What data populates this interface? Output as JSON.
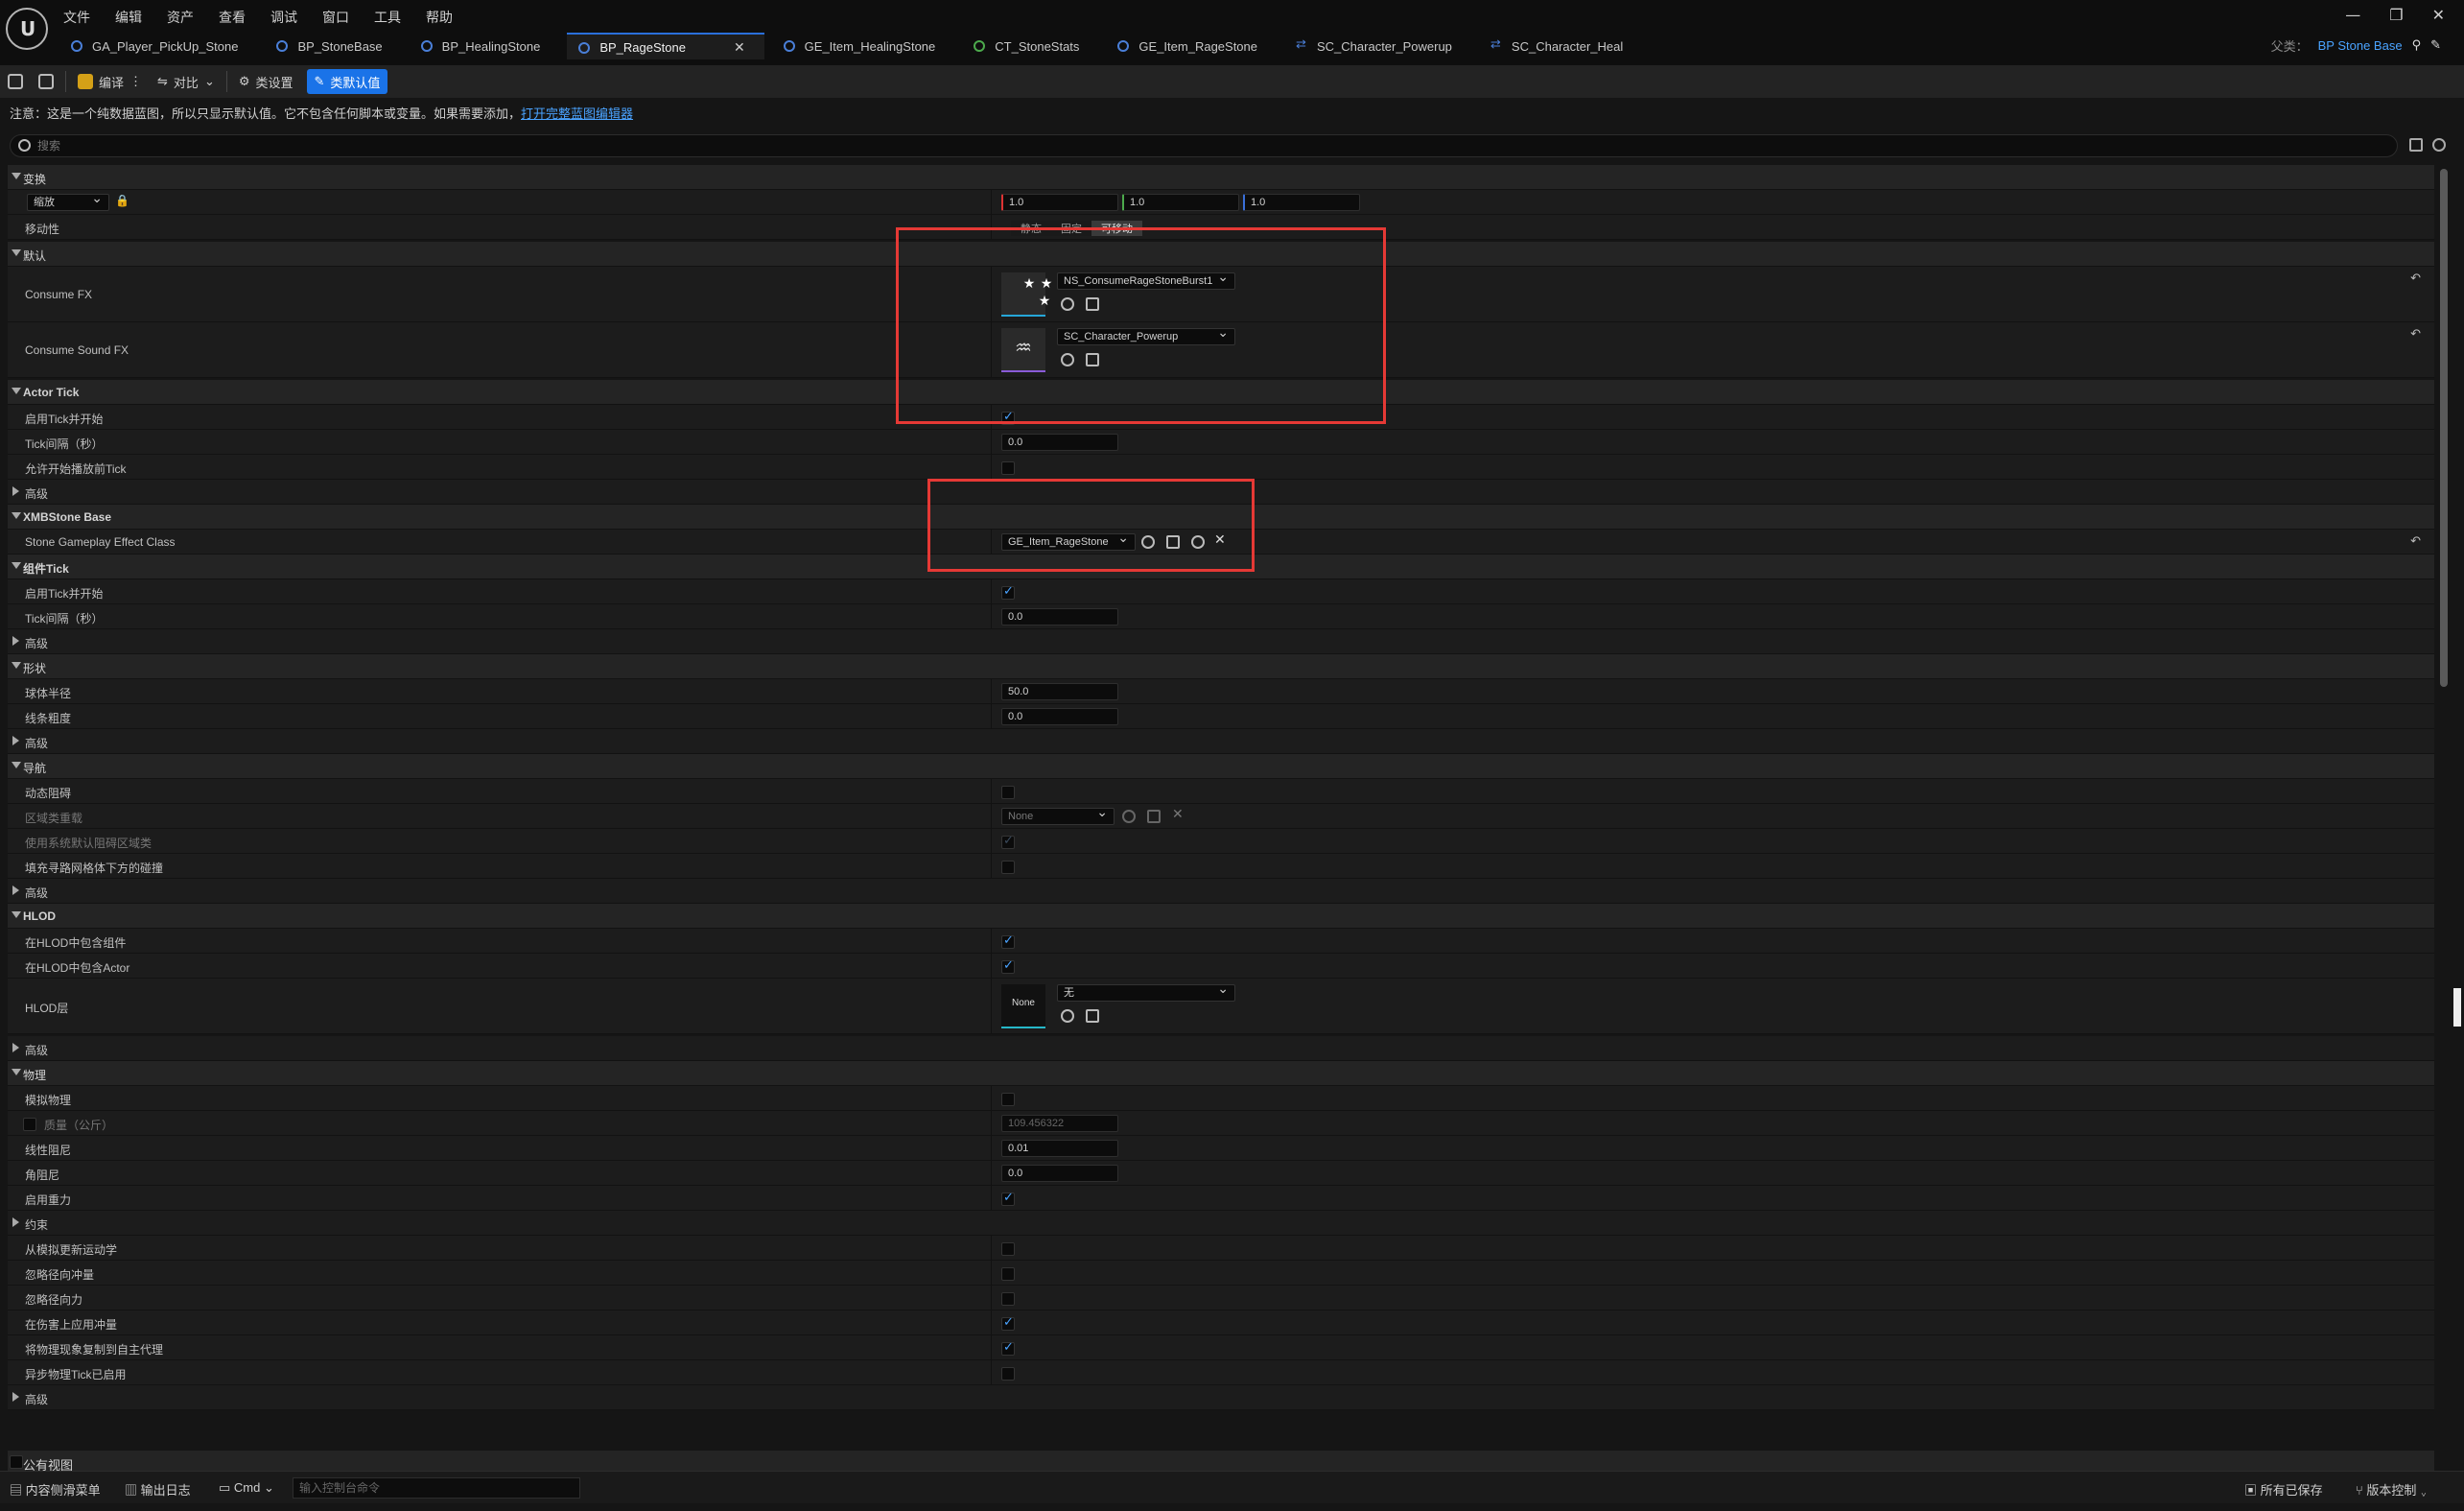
{
  "menu": [
    "文件",
    "编辑",
    "资产",
    "查看",
    "调试",
    "窗口",
    "工具",
    "帮助"
  ],
  "window_controls": [
    "—",
    "❐",
    "✕"
  ],
  "tabs": [
    {
      "label": "GA_Player_PickUp_Stone"
    },
    {
      "label": "BP_StoneBase"
    },
    {
      "label": "BP_HealingStone"
    },
    {
      "label": "BP_RageStone",
      "active": true
    },
    {
      "label": "GE_Item_HealingStone"
    },
    {
      "label": "CT_StoneStats"
    },
    {
      "label": "GE_Item_RageStone"
    },
    {
      "label": "SC_Character_Powerup"
    },
    {
      "label": "SC_Character_Heal"
    }
  ],
  "parent": {
    "label": "父类：",
    "value": "BP Stone Base"
  },
  "toolbar": {
    "compile": "编译",
    "diff": "对比",
    "class_settings": "类设置",
    "class_defaults": "类默认值"
  },
  "notice": {
    "text": "注意：这是一个纯数据蓝图，所以只显示默认值。它不包含任何脚本或变量。如果需要添加，",
    "link": "打开完整蓝图编辑器"
  },
  "search": {
    "placeholder": "搜索"
  },
  "sections": {
    "transform": "变换",
    "scale_label": "缩放",
    "scale": [
      "1.0",
      "1.0",
      "1.0"
    ],
    "mobility_label": "移动性",
    "mobility_options": [
      "静态",
      "固定",
      "可移动"
    ],
    "default": "默认",
    "consume_fx": "Consume FX",
    "consume_fx_value": "NS_ConsumeRageStoneBurst1",
    "consume_sound": "Consume Sound FX",
    "consume_sound_value": "SC_Character_Powerup",
    "actor_tick": "Actor Tick",
    "tick_start": "启用Tick并开始",
    "tick_interval": "Tick间隔（秒）",
    "tick_interval_value": "0.0",
    "tick_before_play": "允许开始播放前Tick",
    "advanced": "高级",
    "xmb": "XMBStone Base",
    "stone_ge": "Stone Gameplay Effect Class",
    "stone_ge_value": "GE_Item_RageStone",
    "comp_tick": "组件Tick",
    "comp_tick_start": "启用Tick并开始",
    "comp_tick_interval": "Tick间隔（秒）",
    "comp_tick_interval_value": "0.0",
    "shape": "形状",
    "sphere_radius": "球体半径",
    "sphere_radius_value": "50.0",
    "line_thickness": "线条粗度",
    "line_thickness_value": "0.0",
    "nav": "导航",
    "dyn_obstacle": "动态阻碍",
    "area_class": "区域类重载",
    "area_class_value": "None",
    "use_sys_area": "使用系统默认阻碍区域类",
    "fill_collision": "填充寻路网格体下方的碰撞",
    "hlod": "HLOD",
    "hlod_incl_comp": "在HLOD中包含组件",
    "hlod_incl_actor": "在HLOD中包含Actor",
    "hlod_layer": "HLOD层",
    "hlod_layer_thumb": "None",
    "hlod_layer_value": "无",
    "physics": "物理",
    "sim_physics": "模拟物理",
    "mass": "质量（公斤）",
    "mass_value": "109.456322",
    "linear_damping": "线性阻尼",
    "linear_damping_value": "0.01",
    "angular_damping": "角阻尼",
    "angular_damping_value": "0.0",
    "gravity": "启用重力",
    "constraints": "约束",
    "update_kinematic": "从模拟更新运动学",
    "ignore_radial_impulse": "忽略径向冲量",
    "ignore_radial_force": "忽略径向力",
    "apply_impulse_on_damage": "在伤害上应用冲量",
    "replicate_physics": "将物理现象复制到自主代理",
    "async_tick": "异步物理Tick已启用",
    "public_view": "公有视图"
  },
  "bottom": {
    "content_drawer": "内容侧滑菜单",
    "output_log": "输出日志",
    "cmd": "Cmd",
    "cmd_placeholder": "输入控制台命令",
    "all_saved": "所有已保存",
    "source_control": "版本控制"
  }
}
